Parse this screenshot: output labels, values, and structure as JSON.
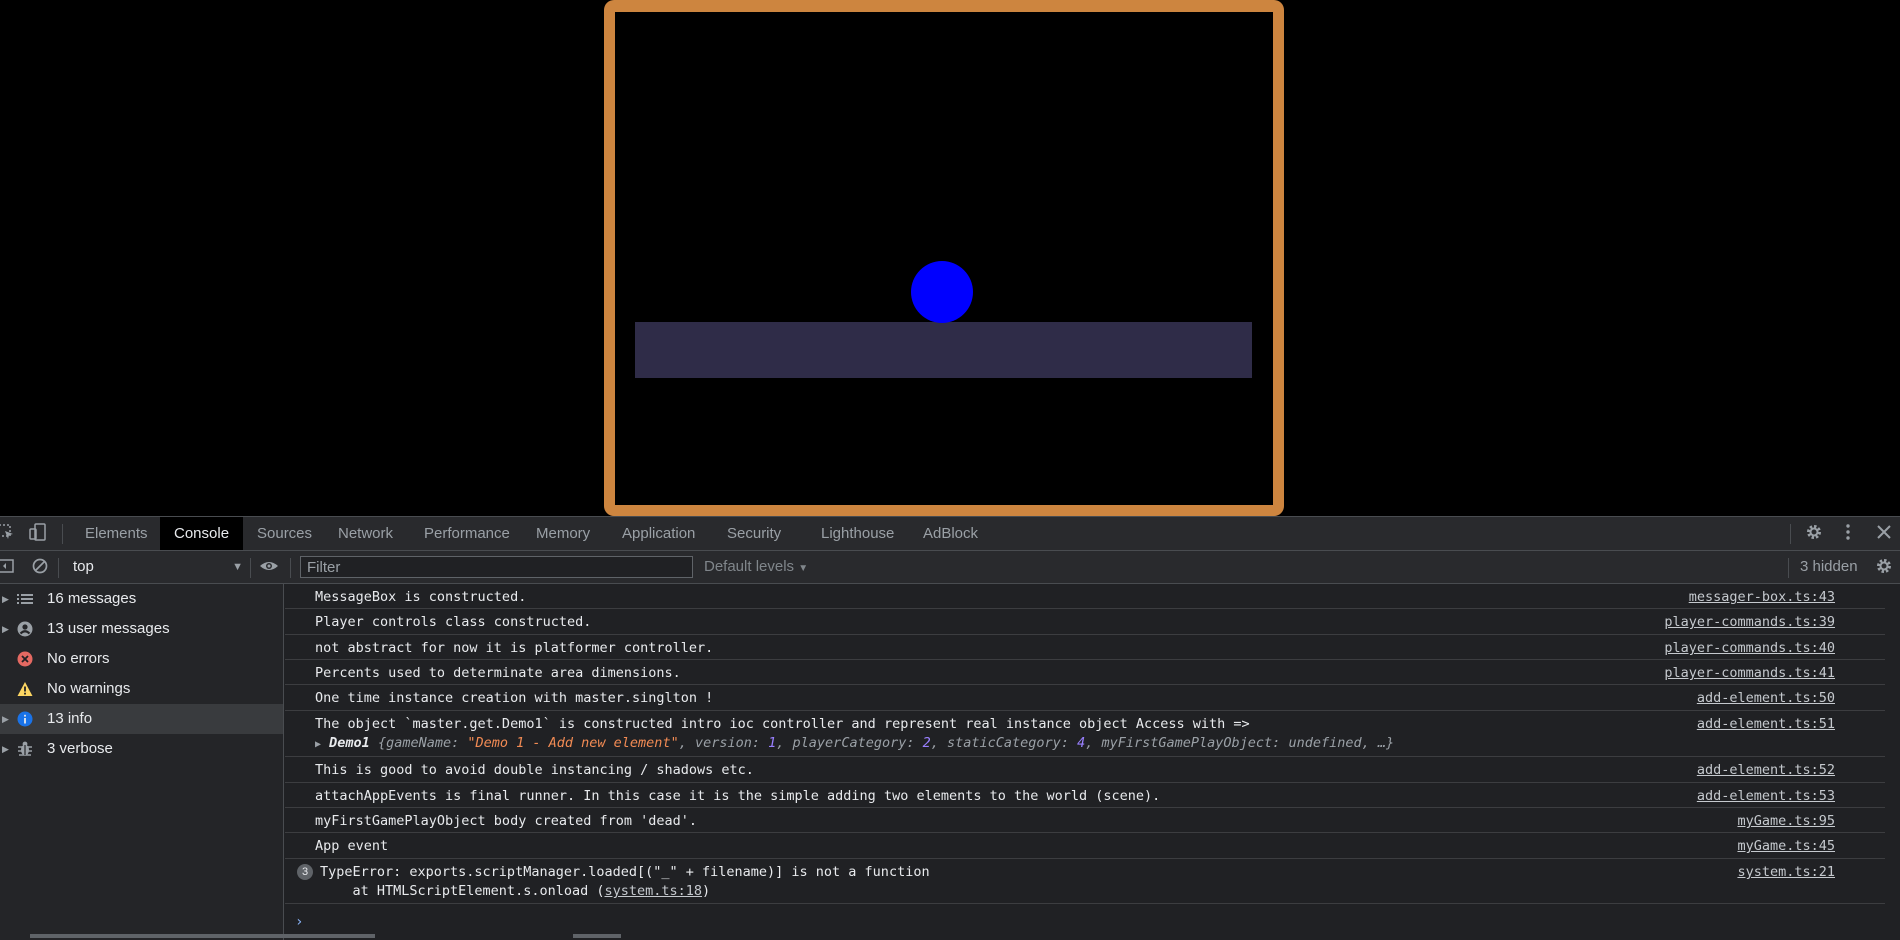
{
  "devtools": {
    "tabs": [
      "Elements",
      "Console",
      "Sources",
      "Network",
      "Performance",
      "Memory",
      "Application",
      "Security",
      "Lighthouse",
      "AdBlock"
    ],
    "active_tab": "Console",
    "icons": {
      "inspect": "inspect-element-icon",
      "device": "device-toolbar-icon",
      "settings": "gear-icon",
      "more": "more-vertical-icon",
      "close": "close-icon"
    }
  },
  "toolbar": {
    "context": "top",
    "filter_placeholder": "Filter",
    "levels": "Default levels",
    "hidden": "3 hidden"
  },
  "sidebar": {
    "items": [
      {
        "label": "16 messages",
        "icon": "list-icon"
      },
      {
        "label": "13 user messages",
        "icon": "user-icon"
      },
      {
        "label": "No errors",
        "icon": "error-icon",
        "color": "#f28b82"
      },
      {
        "label": "No warnings",
        "icon": "warning-icon",
        "color": "#fdd663"
      },
      {
        "label": "13 info",
        "icon": "info-icon",
        "color": "#1a73e8"
      },
      {
        "label": "3 verbose",
        "icon": "bug-icon"
      }
    ],
    "selected": "13 info"
  },
  "console": {
    "messages": [
      {
        "text": "MessageBox is constructed.",
        "source": "messager-box.ts:43"
      },
      {
        "text": "Player controls class constructed.",
        "source": "player-commands.ts:39"
      },
      {
        "text": "not abstract for now it is platformer controller.",
        "source": "player-commands.ts:40"
      },
      {
        "text": "Percents used to determinate area dimensions.",
        "source": "player-commands.ts:41"
      },
      {
        "text": "One time instance creation with master.singlton !",
        "source": "add-element.ts:50"
      },
      {
        "text": "The object `master.get.Demo1` is constructed intro ioc controller and represent real instance object Access with =>",
        "source": "add-element.ts:51"
      },
      {
        "text": "This is good to avoid double instancing / shadows etc.",
        "source": "add-element.ts:52"
      },
      {
        "text": "attachAppEvents is final runner. In this case it is the simple adding two elements to the world (scene).",
        "source": "add-element.ts:53"
      },
      {
        "text": "myFirstGamePlayObject body created from 'dead'.",
        "source": "myGame.ts:95"
      },
      {
        "text": "App event",
        "source": "myGame.ts:45"
      }
    ],
    "object_preview": {
      "name": "Demo1",
      "gameName_key": "gameName",
      "gameName_val": "\"Demo 1 - Add new element\"",
      "version_key": "version",
      "version_val": "1",
      "playerCategory_key": "playerCategory",
      "playerCategory_val": "2",
      "staticCategory_key": "staticCategory",
      "staticCategory_val": "4",
      "obj_key": "myFirstGamePlayObject",
      "obj_val": "undefined"
    },
    "error": {
      "count": "3",
      "text": "TypeError: exports.scriptManager.loaded[(\"_\" + filename)] is not a function",
      "stack_prefix": "    at HTMLScriptElement.s.onload (",
      "stack_link": "system.ts:18",
      "stack_suffix": ")",
      "source": "system.ts:21"
    },
    "prompt": "›"
  },
  "game": {
    "frame_color": "#cd853f",
    "ball_color": "#0000ff",
    "platform_color": "#2f2c48"
  }
}
